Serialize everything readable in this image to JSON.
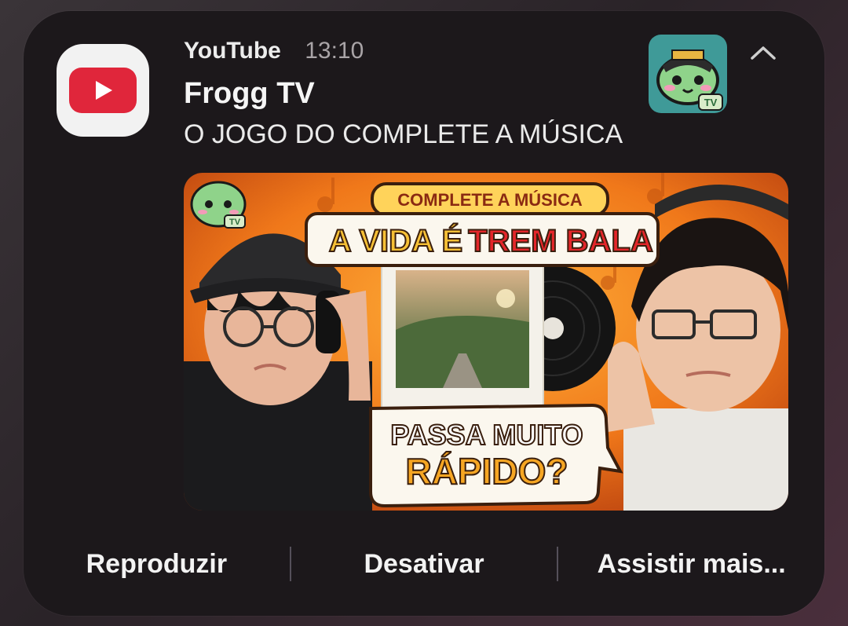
{
  "notification": {
    "app_name": "YouTube",
    "time": "13:10",
    "title": "Frogg TV",
    "subtitle": "O JOGO DO COMPLETE A MÚSICA"
  },
  "thumbnail": {
    "banner_top": "COMPLETE A MÚSICA",
    "banner_main_part1": "A VIDA É",
    "banner_main_part2": "TREM BALA",
    "bubble_line1": "PASSA MUITO",
    "bubble_line2": "RÁPIDO?",
    "logo_text": "TV"
  },
  "actions": {
    "play": "Reproduzir",
    "disable": "Desativar",
    "watch_more": "Assistir mais..."
  },
  "colors": {
    "youtube_red": "#e0263b",
    "thumb_orange": "#f08a1e",
    "banner_red": "#e4262a",
    "banner_yellow": "#ffc83a"
  }
}
